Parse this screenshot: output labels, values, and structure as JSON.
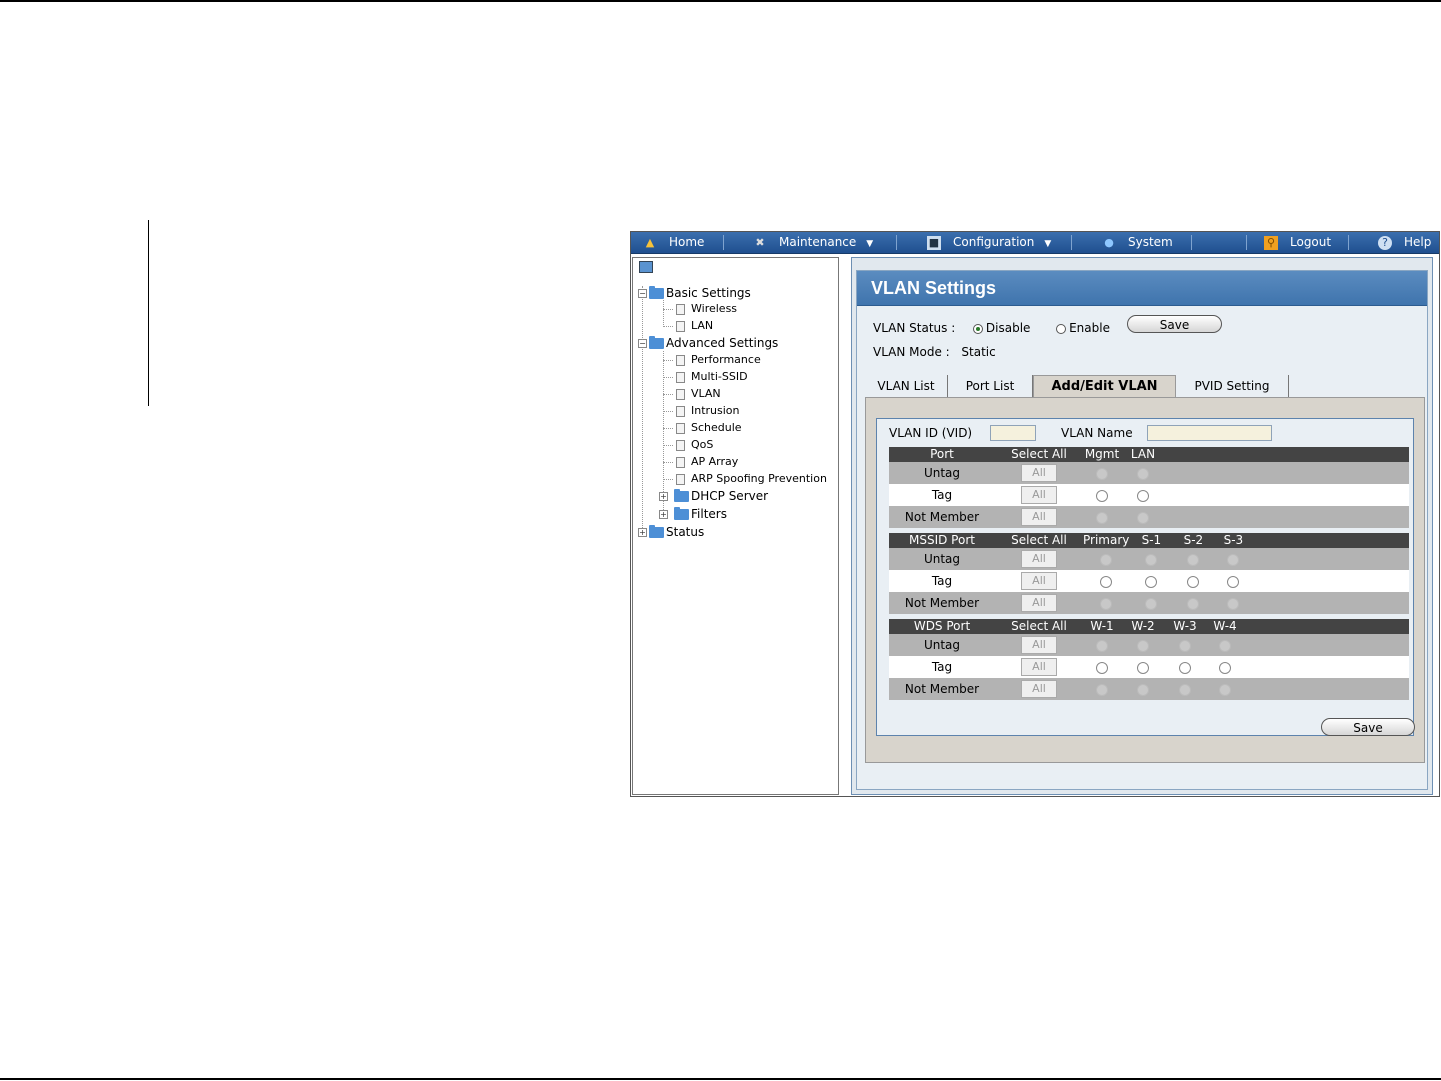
{
  "nav": {
    "home": "Home",
    "maintenance": "Maintenance",
    "configuration": "Configuration",
    "system": "System",
    "logout": "Logout",
    "help": "Help"
  },
  "tree": {
    "basic_settings": "Basic Settings",
    "wireless": "Wireless",
    "lan": "LAN",
    "advanced_settings": "Advanced Settings",
    "performance": "Performance",
    "multi_ssid": "Multi-SSID",
    "vlan": "VLAN",
    "intrusion": "Intrusion",
    "schedule": "Schedule",
    "qos": "QoS",
    "ap_array": "AP Array",
    "arp": "ARP Spoofing Prevention",
    "dhcp_server": "DHCP Server",
    "filters": "Filters",
    "status": "Status"
  },
  "page": {
    "title": "VLAN Settings",
    "vlan_status_label": "VLAN Status :",
    "disable_label": "Disable",
    "enable_label": "Enable",
    "save_label": "Save",
    "vlan_mode_label": "VLAN Mode :",
    "vlan_mode_value": "Static",
    "vlan_status_selected": "Disable"
  },
  "tabs": {
    "vlan_list": "VLAN List",
    "port_list": "Port List",
    "add_edit": "Add/Edit VLAN",
    "pvid": "PVID Setting"
  },
  "form": {
    "vid_label": "VLAN ID (VID)",
    "vid_value": "",
    "name_label": "VLAN Name",
    "name_value": "",
    "all_label": "All",
    "save_label": "Save",
    "untag": "Untag",
    "tag": "Tag",
    "not_member": "Not Member",
    "select_all": "Select All",
    "port_header": "Port",
    "mgmt": "Mgmt",
    "lan": "LAN",
    "mssid_header": "MSSID Port",
    "primary": "Primary",
    "s1": "S-1",
    "s2": "S-2",
    "s3": "S-3",
    "wds_header": "WDS Port",
    "w1": "W-1",
    "w2": "W-2",
    "w3": "W-3",
    "w4": "W-4"
  }
}
